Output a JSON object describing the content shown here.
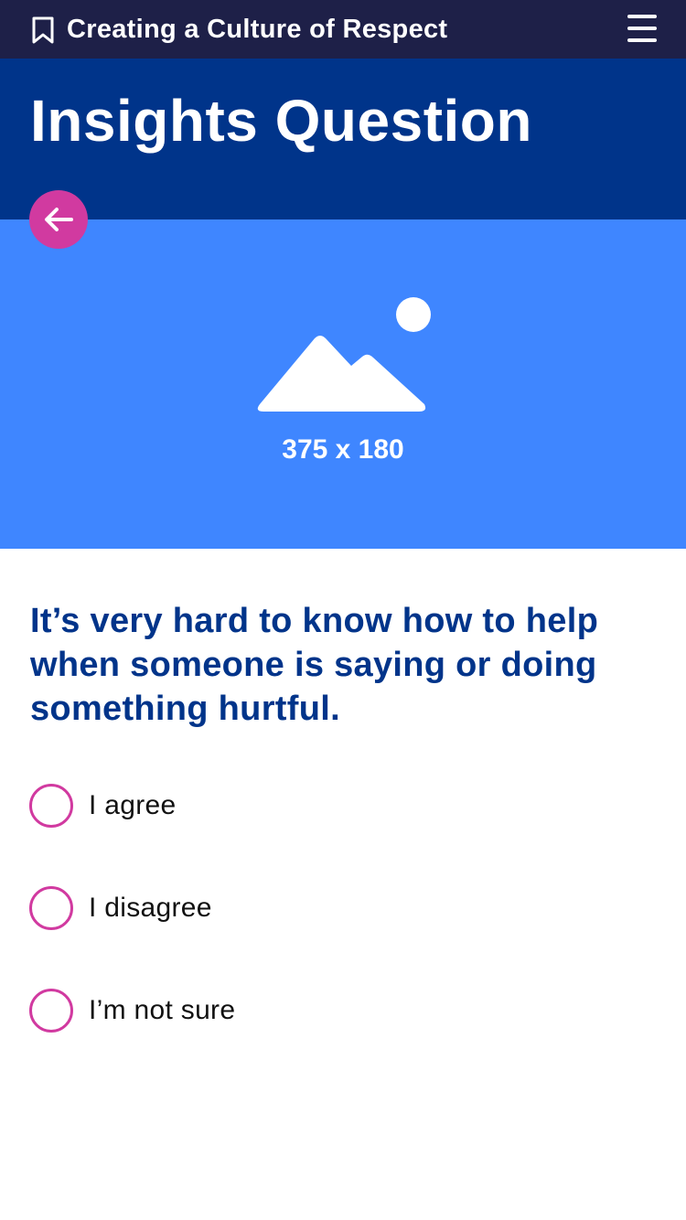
{
  "header_bar": {
    "course_title": "Creating a Culture of Respect",
    "bookmark_icon": "bookmark-icon",
    "menu_icon": "hamburger-menu-icon"
  },
  "page": {
    "title": "Insights Question"
  },
  "back_button": {
    "icon": "arrow-left-icon"
  },
  "hero_image": {
    "placeholder_label": "375 x 180",
    "icon": "image-placeholder-icon"
  },
  "question": {
    "text": "It’s very hard to know how to help when someone is saying or doing something hurtful.",
    "options": [
      {
        "label": "I agree",
        "selected": false
      },
      {
        "label": "I disagree",
        "selected": false
      },
      {
        "label": "I’m not sure",
        "selected": false
      }
    ]
  },
  "colors": {
    "top_bar": "#1e2048",
    "header": "#00348a",
    "hero": "#3f86ff",
    "accent": "#d13aa0",
    "question_text": "#00348a"
  }
}
